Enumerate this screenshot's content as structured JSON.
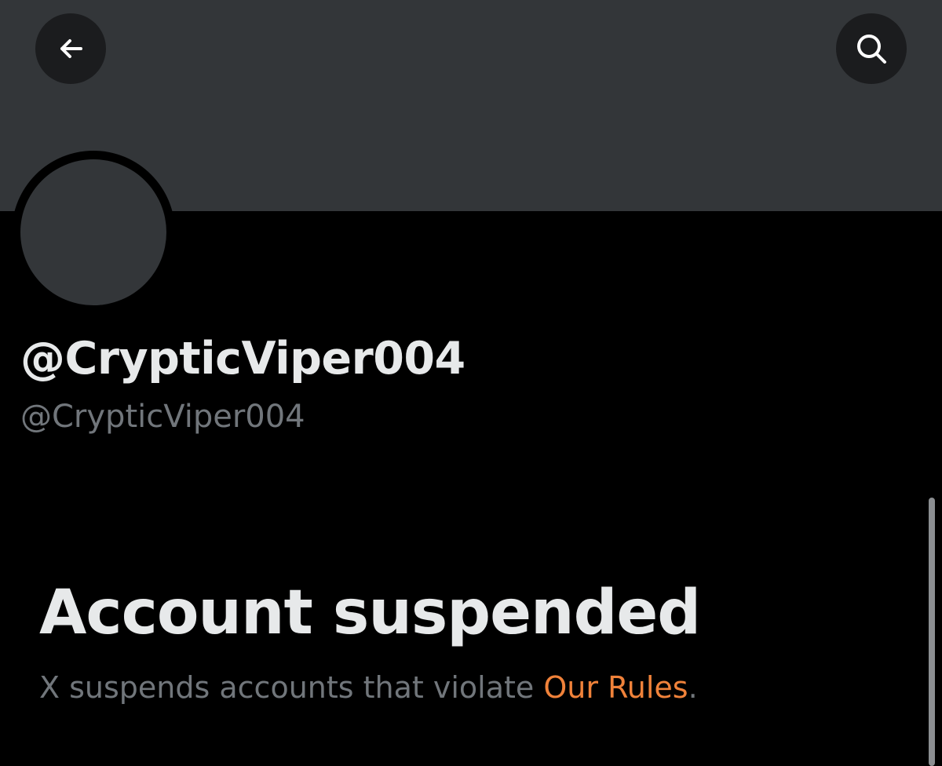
{
  "header": {
    "back_icon": "arrow-left-icon",
    "search_icon": "search-icon"
  },
  "profile": {
    "display_name": "@CrypticViper004",
    "handle": "@CrypticViper004"
  },
  "notice": {
    "title": "Account suspended",
    "description_prefix": "X suspends accounts that violate ",
    "rules_link": "Our Rules",
    "description_suffix": "."
  },
  "colors": {
    "background": "#000000",
    "banner": "#333639",
    "button_bg": "#1b1c1e",
    "primary_text": "#e7e9ea",
    "secondary_text": "#71767b",
    "link": "#f0823a"
  }
}
